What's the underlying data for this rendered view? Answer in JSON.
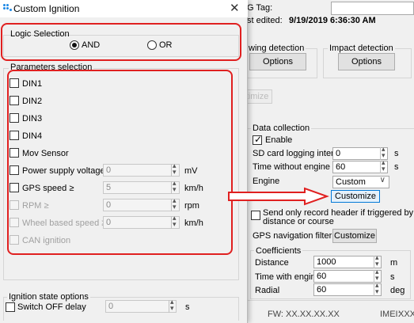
{
  "dialog": {
    "title": "Custom Ignition",
    "logic": {
      "label": "Logic Selection",
      "options": [
        "AND",
        "OR"
      ],
      "selected": "AND"
    },
    "params": {
      "label": "Parameters selection",
      "items": [
        {
          "label": "DIN1",
          "checked": false,
          "enabled": true
        },
        {
          "label": "DIN2",
          "checked": false,
          "enabled": true
        },
        {
          "label": "DIN3",
          "checked": false,
          "enabled": true
        },
        {
          "label": "DIN4",
          "checked": false,
          "enabled": true
        },
        {
          "label": "Mov Sensor",
          "checked": false,
          "enabled": true
        },
        {
          "label": "Power supply voltage ≥",
          "value": "0",
          "unit": "mV",
          "checked": false,
          "enabled": true
        },
        {
          "label": "GPS speed ≥",
          "value": "5",
          "unit": "km/h",
          "checked": false,
          "enabled": true
        },
        {
          "label": "RPM ≥",
          "value": "0",
          "unit": "rpm",
          "checked": false,
          "enabled": false
        },
        {
          "label": "Wheel based speed ≥",
          "value": "0",
          "unit": "km/h",
          "checked": false,
          "enabled": false
        },
        {
          "label": "CAN ignition",
          "checked": false,
          "enabled": false
        }
      ]
    },
    "ignition_state": {
      "label": "Ignition state options",
      "switch_off_label": "Switch OFF delay",
      "switch_off_value": "0",
      "unit": "s"
    }
  },
  "background": {
    "tag_label": "G Tag:",
    "edited_label": "st edited:",
    "edited_value": "9/19/2019 6:36:30 AM",
    "wing_detection_label": "wing detection",
    "impact_detection_label": "Impact detection",
    "options_label": "Options",
    "optimize_label": "ptimize",
    "data_collection": {
      "label": "Data collection",
      "enable_label": "Enable",
      "enable_checked": true,
      "sd_label": "SD card logging interval",
      "sd_value": "0",
      "sd_unit": "s",
      "time_wo_engine_label": "Time without engine",
      "time_wo_engine_value": "60",
      "time_wo_engine_unit": "s",
      "engine_label": "Engine",
      "engine_value": "Custom",
      "customize_label": "Customize",
      "send_only_label_1": "Send only record header if triggered by time,",
      "send_only_label_2": "distance or course",
      "gps_filter_label": "GPS navigation filtering",
      "gps_customize_label": "Customize"
    },
    "coefficients": {
      "label": "Coefficients",
      "rows": [
        {
          "label": "Distance",
          "value": "1000",
          "unit": "m"
        },
        {
          "label": "Time with engine",
          "value": "60",
          "unit": "s"
        },
        {
          "label": "Radial",
          "value": "60",
          "unit": "deg"
        }
      ]
    },
    "fw_label": "FW:",
    "fw_value": "XX.XX.XX.XX",
    "imei_label": "IMEI:",
    "imei_value": "XXX"
  },
  "colors": {
    "highlight": "#e02020",
    "accent": "#0078d7",
    "icon_blue": "#1e88e5"
  }
}
